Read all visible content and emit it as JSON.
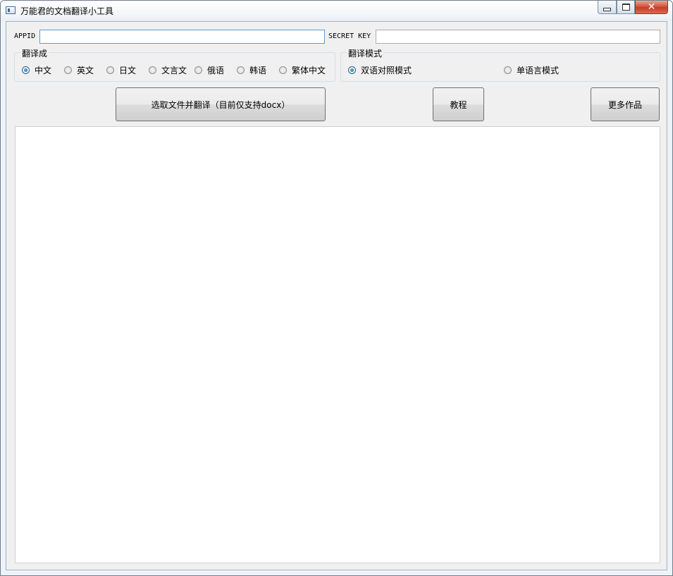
{
  "window": {
    "title": "万能君的文档翻译小工具",
    "close_glyph": "✕"
  },
  "credentials": {
    "appid_label": "APPID",
    "appid_value": "",
    "secret_label": "SECRET KEY",
    "secret_value": ""
  },
  "target_language": {
    "group_title": "翻译成",
    "selected": "中文",
    "options": [
      "中文",
      "英文",
      "日文",
      "文言文",
      "俄语",
      "韩语",
      "繁体中文"
    ]
  },
  "translate_mode": {
    "group_title": "翻译模式",
    "selected": "双语对照模式",
    "options": [
      "双语对照模式",
      "单语言模式"
    ]
  },
  "buttons": {
    "select_file": "选取文件并翻译（目前仅支持docx）",
    "tutorial": "教程",
    "more_works": "更多作品"
  },
  "output": {
    "text": ""
  },
  "colors": {
    "radio_checked": "#1f5e92",
    "close_button": "#c33f28",
    "client_bg": "#f0f0f0"
  }
}
